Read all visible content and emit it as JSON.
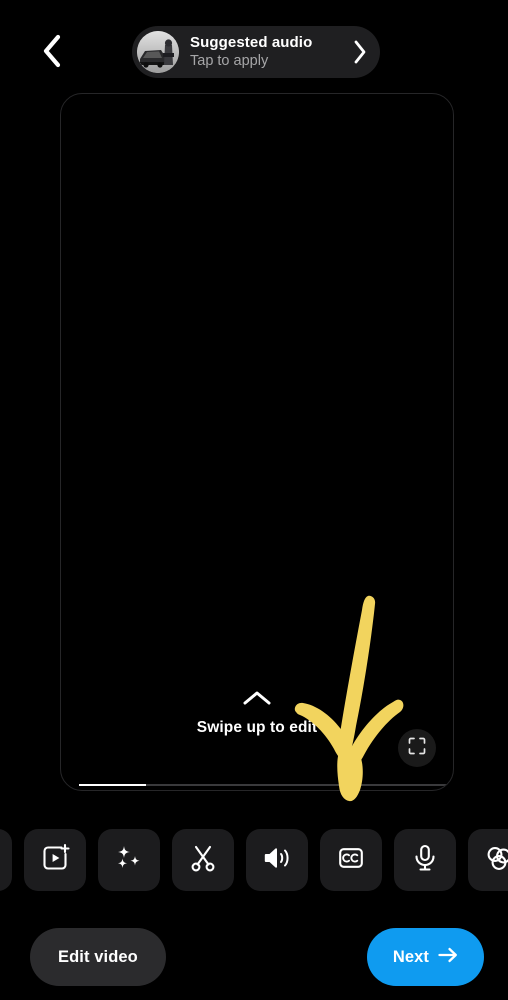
{
  "screen": {
    "name": "video-editor-preview",
    "background_color": "#000000"
  },
  "topbar": {
    "back_icon": "chevron-left-icon",
    "audio_suggestion": {
      "title": "Suggested audio",
      "subtitle": "Tap to apply",
      "thumbnail_icon": "audio-artwork-thumbnail",
      "chevron_icon": "chevron-right-icon",
      "background_color": "#1f1f21"
    }
  },
  "preview": {
    "swipe_hint_label": "Swipe up to edit",
    "swipe_chevron_icon": "chevron-up-icon",
    "expand_icon": "fullscreen-expand-icon",
    "progress_percent": 18,
    "border_color": "#262628"
  },
  "annotation": {
    "arrow_icon": "hand-drawn-down-arrow",
    "color": "#f2d45e"
  },
  "toolbar": {
    "background_color": "#1c1c1e",
    "items": [
      {
        "name": "partial-left-tool",
        "icon": "tool-icon",
        "label": ""
      },
      {
        "name": "add-clip",
        "icon": "add-clip-icon",
        "label": "Add clip"
      },
      {
        "name": "effects",
        "icon": "sparkles-icon",
        "label": "Effects"
      },
      {
        "name": "trim",
        "icon": "scissors-icon",
        "label": "Trim"
      },
      {
        "name": "volume",
        "icon": "speaker-volume-icon",
        "label": "Volume"
      },
      {
        "name": "captions",
        "icon": "closed-captions-icon",
        "label": "Captions"
      },
      {
        "name": "voiceover",
        "icon": "microphone-icon",
        "label": "Voiceover"
      },
      {
        "name": "filters",
        "icon": "color-filters-icon",
        "label": "Filters"
      }
    ]
  },
  "actions": {
    "edit_video_label": "Edit video",
    "next_label": "Next",
    "next_icon": "arrow-right-icon",
    "next_color": "#0f9bf0",
    "edit_color": "#2b2b2d"
  }
}
